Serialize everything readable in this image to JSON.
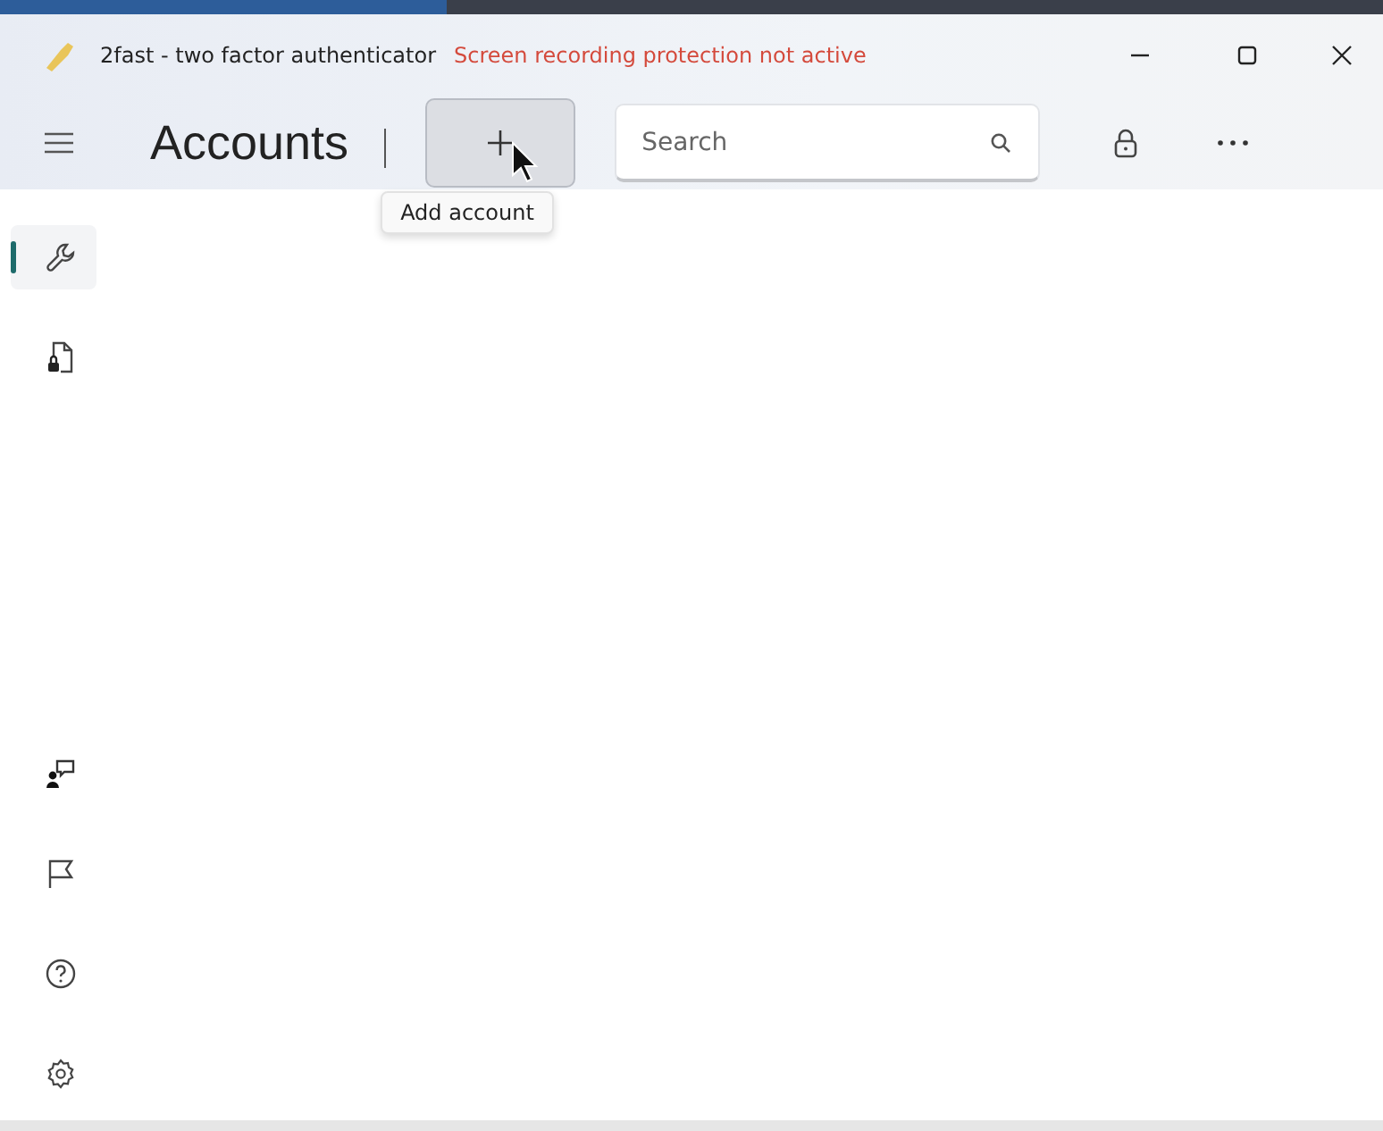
{
  "window": {
    "title": "2fast - two factor authenticator",
    "warning": "Screen recording protection not active"
  },
  "toolbar": {
    "page_title": "Accounts",
    "add_button": {
      "tooltip": "Add account"
    },
    "search": {
      "placeholder": "Search"
    }
  },
  "sidebar": {
    "top_items": [
      {
        "selected": true
      },
      {
        "selected": false
      }
    ],
    "bottom_items": [
      {
        "selected": false
      },
      {
        "selected": false
      },
      {
        "selected": false
      },
      {
        "selected": false
      }
    ]
  }
}
